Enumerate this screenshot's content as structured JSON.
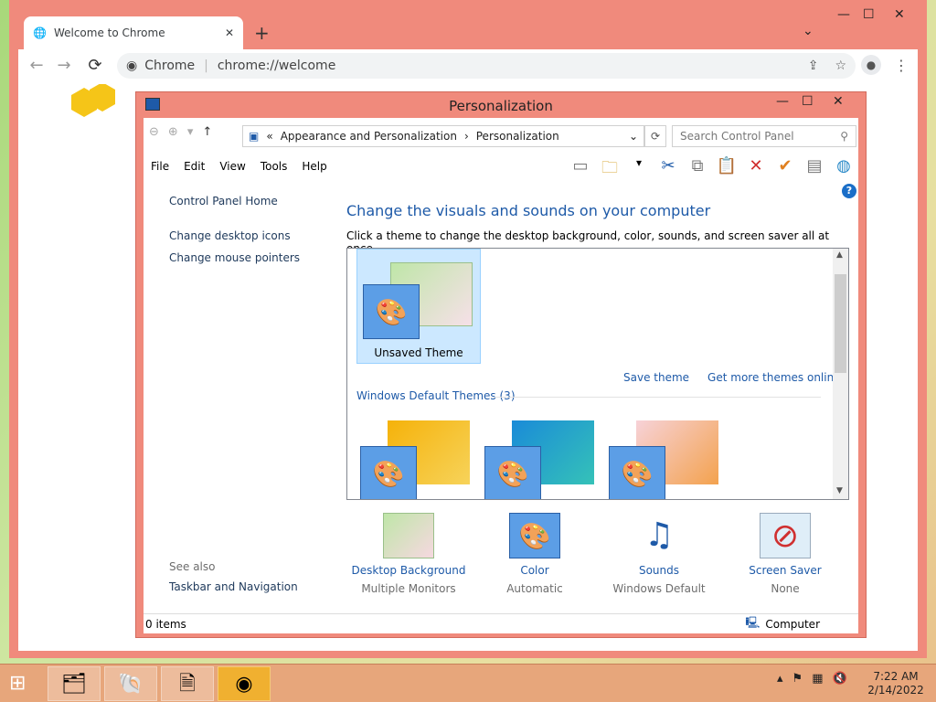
{
  "chrome": {
    "tab_title": "Welcome to Chrome",
    "omnibox_label": "Chrome",
    "url": "chrome://welcome"
  },
  "cp": {
    "window_title": "Personalization",
    "breadcrumb": [
      "Appearance and Personalization",
      "Personalization"
    ],
    "search_placeholder": "Search Control Panel",
    "menu": [
      "File",
      "Edit",
      "View",
      "Tools",
      "Help"
    ],
    "sidebar_links": [
      "Control Panel Home",
      "Change desktop icons",
      "Change mouse pointers"
    ],
    "see_also_label": "See also",
    "see_also_link": "Taskbar and Navigation",
    "heading": "Change the visuals and sounds on your computer",
    "subheading": "Click a theme to change the desktop background, color, sounds, and screen saver all at once.",
    "unsaved_theme": "Unsaved Theme",
    "save_theme": "Save theme",
    "get_more": "Get more themes online",
    "group_label": "Windows Default Themes (3)",
    "bottom": [
      {
        "name": "Desktop Background",
        "value": "Multiple Monitors"
      },
      {
        "name": "Color",
        "value": "Automatic"
      },
      {
        "name": "Sounds",
        "value": "Windows Default"
      },
      {
        "name": "Screen Saver",
        "value": "None"
      }
    ],
    "status_items": "0 items",
    "status_location": "Computer"
  },
  "taskbar": {
    "time": "7:22 AM",
    "date": "2/14/2022"
  }
}
